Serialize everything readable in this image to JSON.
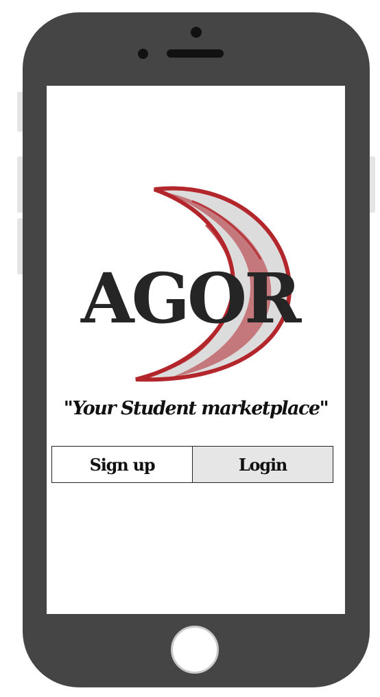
{
  "logo": {
    "text": "AGORA",
    "colors": {
      "moon": "#b3262c",
      "moon_fill": "#dcdcdc",
      "text": "#252525"
    }
  },
  "tagline": "\"Your Student marketplace\"",
  "buttons": {
    "signup_label": "Sign up",
    "login_label": "Login"
  },
  "colors": {
    "phone_body": "#454545",
    "screen": "#ffffff",
    "login_bg": "#e6e6e6"
  }
}
